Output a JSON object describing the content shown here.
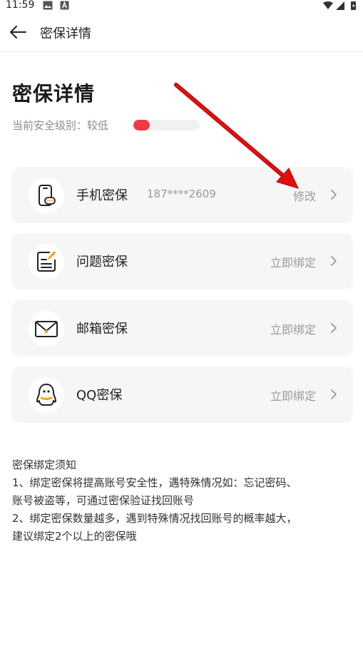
{
  "status_bar": {
    "time": "11:59"
  },
  "header": {
    "title": "密保详情"
  },
  "page": {
    "title": "密保详情",
    "security_level_label": "当前安全级别：",
    "security_level_value": "较低",
    "security_level_fraction": 0.25,
    "level_color": "#f0394a"
  },
  "items": [
    {
      "icon": "phone-icon",
      "title": "手机密保",
      "subtitle": "187****2609",
      "action": "修改"
    },
    {
      "icon": "question-icon",
      "title": "问题密保",
      "subtitle": "",
      "action": "立即绑定"
    },
    {
      "icon": "mail-icon",
      "title": "邮箱密保",
      "subtitle": "",
      "action": "立即绑定"
    },
    {
      "icon": "qq-icon",
      "title": "QQ密保",
      "subtitle": "",
      "action": "立即绑定"
    }
  ],
  "notice": {
    "title": "密保绑定须知",
    "lines": [
      "1、绑定密保将提高账号安全性，遇特殊情况如：忘记密码、",
      "账号被盗等，可通过密保验证找回账号",
      "2、绑定密保数量越多，遇到特殊情况找回账号的概率越大，",
      "建议绑定2个以上的密保哦"
    ]
  },
  "colors": {
    "accent": "#f5a31a",
    "annotation_arrow": "#e01010"
  }
}
